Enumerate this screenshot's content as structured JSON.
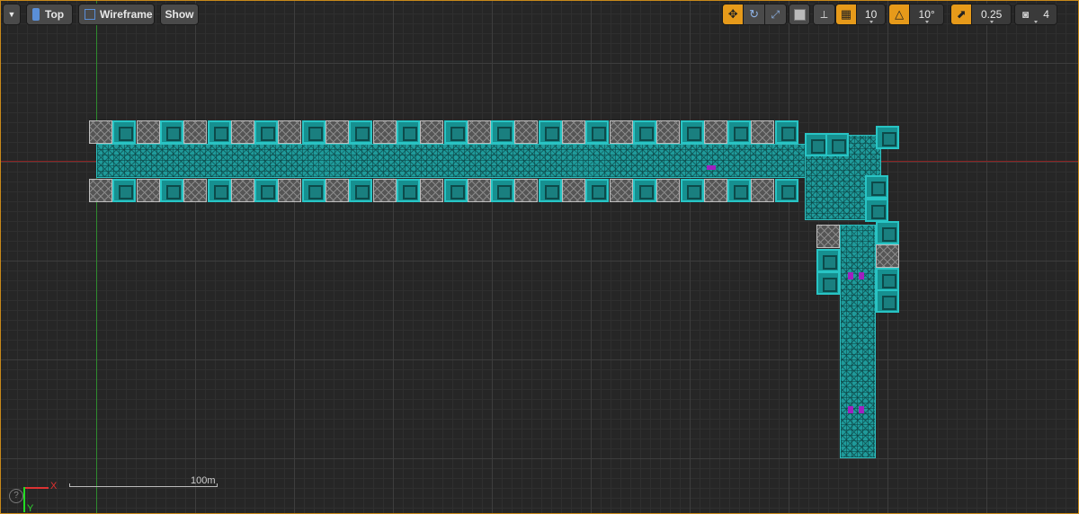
{
  "toolbar": {
    "menu_icon": "chevron-down-icon",
    "view_mode": "Top",
    "render_mode": "Wireframe",
    "show_label": "Show",
    "grid_snap_value": "10",
    "rotation_snap_value": "10°",
    "scale_snap_value": "0.25",
    "camera_speed_value": "4"
  },
  "scale": {
    "label": "100m"
  },
  "axes": {
    "x_label": "X",
    "y_label": "Y"
  },
  "help": {
    "icon": "help-icon",
    "glyph": "?"
  },
  "colors": {
    "accent": "#e69a1a",
    "geometry": "#1f9a9a",
    "axis_x": "#8b2222",
    "axis_y": "#2e8b2e"
  }
}
